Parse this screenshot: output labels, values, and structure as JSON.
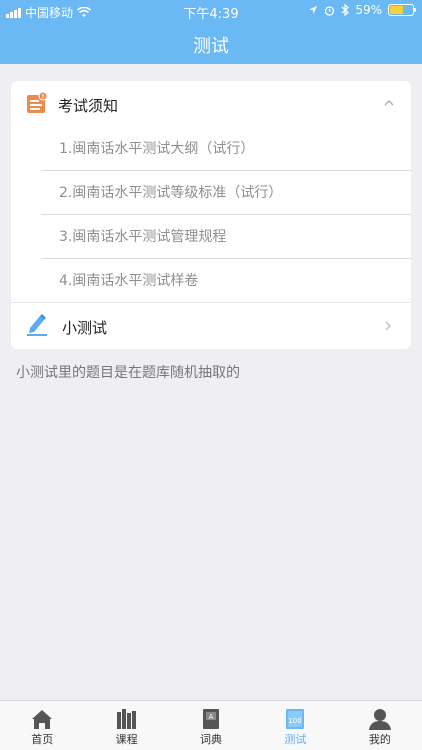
{
  "status_bar": {
    "carrier": "中国移动",
    "time": "下午4:39",
    "battery": "59%",
    "battery_level": 0.59
  },
  "header": {
    "title": "测试"
  },
  "exam_notice": {
    "title": "考试须知",
    "items": [
      {
        "label": "1.闽南话水平测试大纲（试行）"
      },
      {
        "label": "2.闽南话水平测试等级标准（试行）"
      },
      {
        "label": "3.闽南话水平测试管理规程"
      },
      {
        "label": "4.闽南话水平测试样卷"
      }
    ]
  },
  "quiz": {
    "label": "小测试"
  },
  "note": "小测试里的题目是在题库随机抽取的",
  "tabs": [
    {
      "label": "首页",
      "icon": "home-icon"
    },
    {
      "label": "课程",
      "icon": "books-icon"
    },
    {
      "label": "词典",
      "icon": "dictionary-icon"
    },
    {
      "label": "测试",
      "icon": "test-icon",
      "active": true
    },
    {
      "label": "我的",
      "icon": "profile-icon"
    }
  ],
  "colors": {
    "header": "#6ab8f4",
    "accent": "#5aacf0",
    "doc_icon": "#f08a4b",
    "background": "#efeef3"
  }
}
